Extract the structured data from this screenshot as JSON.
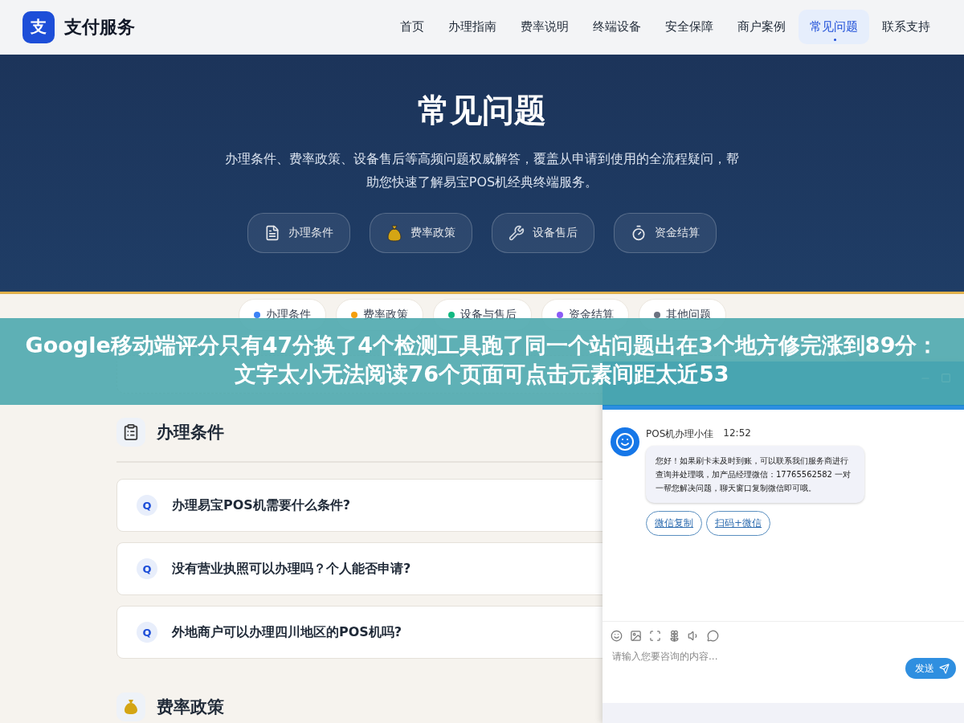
{
  "brand": {
    "logo": "支",
    "name": "支付服务"
  },
  "nav": [
    {
      "label": "首页",
      "selected": false
    },
    {
      "label": "办理指南",
      "selected": false
    },
    {
      "label": "费率说明",
      "selected": false
    },
    {
      "label": "终端设备",
      "selected": false
    },
    {
      "label": "安全保障",
      "selected": false
    },
    {
      "label": "商户案例",
      "selected": false
    },
    {
      "label": "常见问题",
      "selected": true
    },
    {
      "label": "联系支持",
      "selected": false
    }
  ],
  "hero": {
    "title": "常见问题",
    "subtitle": "办理条件、费率政策、设备售后等高频问题权威解答，覆盖从申请到使用的全流程疑问，帮助您快速了解易宝POS机经典终端服务。",
    "shortcuts": [
      {
        "kind": "memo",
        "label": "办理条件"
      },
      {
        "kind": "money",
        "label": "费率政策"
      },
      {
        "kind": "wrench",
        "label": "设备售后"
      },
      {
        "kind": "timer",
        "label": "资金结算"
      }
    ]
  },
  "filters": [
    {
      "label": "办理条件",
      "color": "#3b82f6"
    },
    {
      "label": "费率政策",
      "color": "#f59e0b"
    },
    {
      "label": "设备与售后",
      "color": "#10b981"
    },
    {
      "label": "资金结算",
      "color": "#8b5cf6"
    },
    {
      "label": "其他问题",
      "color": "#6b7280"
    }
  ],
  "section": {
    "title": "办理条件",
    "questions": [
      {
        "marker": "Q",
        "text": "办理易宝POS机需要什么条件?"
      },
      {
        "marker": "Q",
        "text": "没有营业执照可以办理吗？个人能否申请?"
      },
      {
        "marker": "Q",
        "text": "外地商户可以办理四川地区的POS机吗?"
      }
    ]
  },
  "next_section": {
    "title": "费率政策"
  },
  "banner": {
    "text": "Google移动端评分只有47分换了4个检测工具跑了同一个站问题出在3个地方修完涨到89分：文字太小无法阅读76个页面可点击元素间距太近53"
  },
  "chat": {
    "agent": "POS机办理小佳",
    "time": "12:52",
    "message": "您好！如果刷卡未及时到账，可以联系我们服务商进行查询并处理哦，加产品经理微信：17765562582 一对一帮您解决问题，聊天窗口复制微信即可哦。",
    "actions": [
      "微信复制",
      "扫码+微信"
    ],
    "input": {
      "placeholder": "请输入您要咨询的内容..."
    },
    "send": "发送"
  }
}
